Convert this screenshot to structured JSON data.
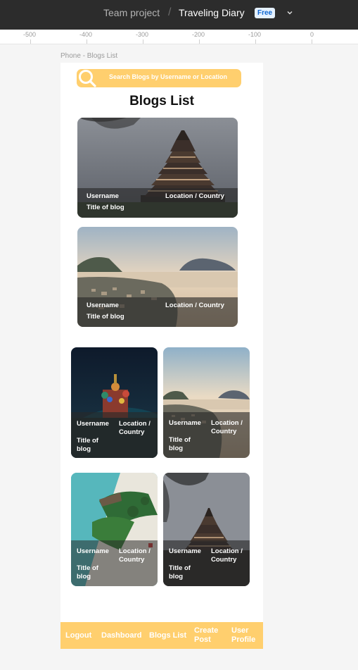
{
  "editor": {
    "team": "Team project",
    "separator": "/",
    "file": "Traveling Diary",
    "plan_badge": "Free"
  },
  "ruler": {
    "ticks": [
      "-500",
      "-400",
      "-300",
      "-200",
      "-100",
      "0"
    ]
  },
  "frame_label": "Phone - Blogs List",
  "search": {
    "placeholder": "Search Blogs by Username or Location"
  },
  "page_title": "Blogs List",
  "cards": [
    {
      "username": "Username",
      "title": "Title of blog",
      "location": "Location / Country",
      "image": "japanese-castle"
    },
    {
      "username": "Username",
      "title": "Title of blog",
      "location": "Location / Country",
      "image": "coastal-town"
    },
    {
      "username": "Username",
      "title": "Title of blog",
      "location": "Location / Country",
      "image": "night-cathedral"
    },
    {
      "username": "Username",
      "title": "Title of blog",
      "location": "Location / Country",
      "image": "coastal-town"
    },
    {
      "username": "Username",
      "title": "Title of blog",
      "location": "Location / Country",
      "image": "tropical-beach"
    },
    {
      "username": "Username",
      "title": "Title of blog",
      "location": "Location / Country",
      "image": "japanese-castle"
    }
  ],
  "nav": {
    "logout": "Logout",
    "dashboard": "Dashboard",
    "blogs_list": "Blogs List",
    "create_post": "Create Post",
    "user_profile": "User Profile"
  },
  "colors": {
    "accent": "#ffcf6e",
    "topbar": "#2c2c2c",
    "badge_bg": "#e5f1ff",
    "badge_text": "#0d66d0"
  }
}
